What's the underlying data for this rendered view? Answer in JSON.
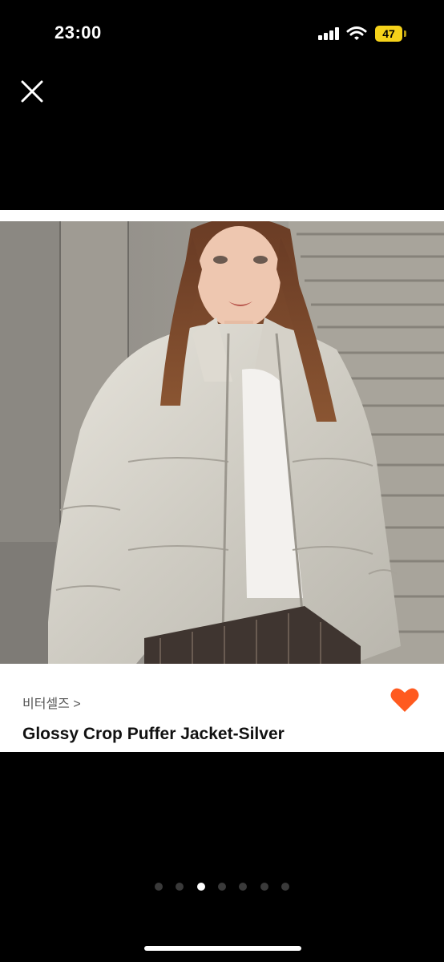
{
  "status_bar": {
    "time": "23:00",
    "battery_level": "47",
    "icons": [
      "signal-icon",
      "wifi-icon",
      "battery-icon"
    ]
  },
  "viewer": {
    "close_icon": "close-icon",
    "active_page_index": 2,
    "page_count": 7
  },
  "product": {
    "brand": "비터셀즈 >",
    "title": "Glossy Crop Puffer Jacket-Silver",
    "favorited": true,
    "heart_color": "#ff5a1f"
  },
  "colors": {
    "background": "#000000",
    "battery": "#f5d21a",
    "heart": "#ff5a1f"
  }
}
